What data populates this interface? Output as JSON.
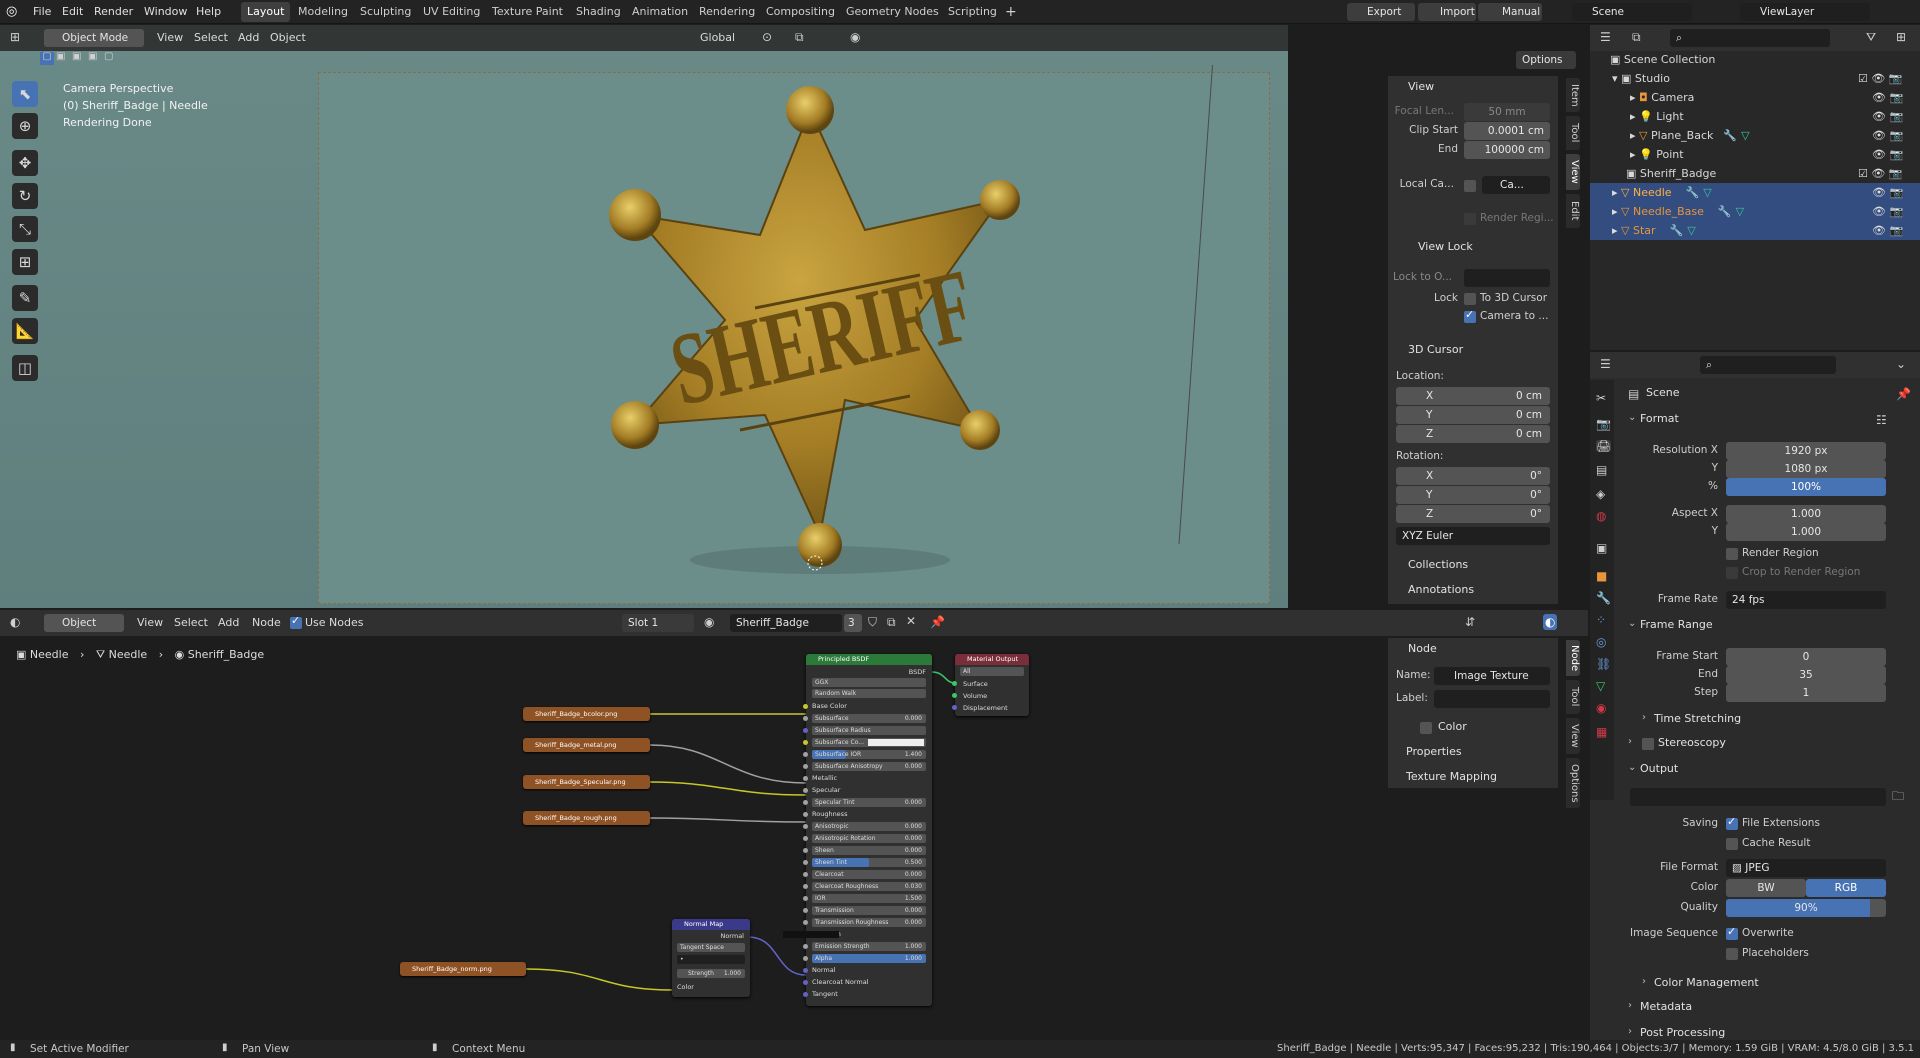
{
  "topbar": {
    "menus": [
      "File",
      "Edit",
      "Render",
      "Window",
      "Help"
    ],
    "workspaces": [
      "Layout",
      "Modeling",
      "Sculpting",
      "UV Editing",
      "Texture Paint",
      "Shading",
      "Animation",
      "Rendering",
      "Compositing",
      "Geometry Nodes",
      "Scripting"
    ],
    "add_tab": "+",
    "export": "Export",
    "import": "Import",
    "manual": "Manual",
    "scene": "Scene",
    "view_layer": "ViewLayer"
  },
  "viewport": {
    "mode": "Object Mode",
    "menus": [
      "View",
      "Select",
      "Add",
      "Object"
    ],
    "orientation": "Global",
    "options": "Options",
    "info_line1": "Camera Perspective",
    "info_line2": "(0) Sheriff_Badge | Needle",
    "info_line3": "Rendering Done",
    "badge_text": "SHERIFF",
    "sidebar": {
      "tabs": [
        "Item",
        "Tool",
        "View",
        "Edit"
      ],
      "view_title": "View",
      "focal_label": "Focal Len...",
      "focal_value": "50 mm",
      "clip_start_label": "Clip Start",
      "clip_start_value": "0.0001 cm",
      "end_label": "End",
      "end_value": "100000 cm",
      "local_camera_label": "Local Ca...",
      "local_camera_value": "Ca...",
      "render_region": "Render Regi...",
      "view_lock_title": "View Lock",
      "lock_to_label": "Lock to O...",
      "lock_label": "Lock",
      "to_3d_cursor": "To 3D Cursor",
      "camera_to": "Camera to ...",
      "cursor_title": "3D Cursor",
      "location_label": "Location:",
      "rotation_label": "Rotation:",
      "x": "X",
      "y": "Y",
      "z": "Z",
      "loc_x": "0 cm",
      "loc_y": "0 cm",
      "loc_z": "0 cm",
      "rot_x": "0°",
      "rot_y": "0°",
      "rot_z": "0°",
      "rotation_mode": "XYZ Euler",
      "collections": "Collections",
      "annotations": "Annotations"
    }
  },
  "node_editor": {
    "object_menu": "Object",
    "menus": [
      "View",
      "Select",
      "Add",
      "Node"
    ],
    "use_nodes": "Use Nodes",
    "slot": "Slot 1",
    "material": "Sheriff_Badge",
    "users": "3",
    "breadcrumb": [
      "Needle",
      "Needle",
      "Sheriff_Badge"
    ],
    "textures": [
      "Sheriff_Badge_bcolor.png",
      "Sheriff_Badge_metal.png",
      "Sheriff_Badge_Specular.png",
      "Sheriff_Badge_rough.png",
      "Sheriff_Badge_norm.png"
    ],
    "bsdf": {
      "title": "Principled BSDF",
      "out": "BSDF",
      "dist": "GGX",
      "sss_method": "Random Walk",
      "rows": [
        [
          "Base Color",
          ""
        ],
        [
          "Subsurface",
          "0.000"
        ],
        [
          "Subsurface Radius",
          ""
        ],
        [
          "Subsurface Co...",
          ""
        ],
        [
          "Subsurface IOR",
          "1.400"
        ],
        [
          "Subsurface Anisotropy",
          "0.000"
        ],
        [
          "Metallic",
          ""
        ],
        [
          "Specular",
          ""
        ],
        [
          "Specular Tint",
          "0.000"
        ],
        [
          "Roughness",
          ""
        ],
        [
          "Anisotropic",
          "0.000"
        ],
        [
          "Anisotropic Rotation",
          "0.000"
        ],
        [
          "Sheen",
          "0.000"
        ],
        [
          "Sheen Tint",
          "0.500"
        ],
        [
          "Clearcoat",
          "0.000"
        ],
        [
          "Clearcoat Roughness",
          "0.030"
        ],
        [
          "IOR",
          "1.500"
        ],
        [
          "Transmission",
          "0.000"
        ],
        [
          "Transmission Roughness",
          "0.000"
        ],
        [
          "Emission",
          ""
        ],
        [
          "Emission Strength",
          "1.000"
        ],
        [
          "Alpha",
          "1.000"
        ],
        [
          "Normal",
          ""
        ],
        [
          "Clearcoat Normal",
          ""
        ],
        [
          "Tangent",
          ""
        ]
      ]
    },
    "output": {
      "title": "Material Output",
      "target": "All",
      "rows": [
        "Surface",
        "Volume",
        "Displacement"
      ]
    },
    "normal_map": {
      "title": "Normal Map",
      "out": "Normal",
      "space": "Tangent Space",
      "strength_label": "Strength",
      "strength": "1.000",
      "color": "Color"
    },
    "sidebar": {
      "tabs": [
        "Node",
        "Tool",
        "View",
        "Options"
      ],
      "node_title": "Node",
      "name_label": "Name:",
      "name_value": "Image Texture",
      "label_label": "Label:",
      "color": "Color",
      "properties": "Properties",
      "texture_mapping": "Texture Mapping"
    }
  },
  "outliner": {
    "items": [
      {
        "name": "Scene Collection"
      },
      {
        "name": "Studio"
      },
      {
        "name": "Camera"
      },
      {
        "name": "Light"
      },
      {
        "name": "Plane_Back"
      },
      {
        "name": "Point"
      },
      {
        "name": "Sheriff_Badge"
      },
      {
        "name": "Needle"
      },
      {
        "name": "Needle_Base"
      },
      {
        "name": "Star"
      }
    ]
  },
  "properties": {
    "scene": "Scene",
    "format": "Format",
    "res_x_label": "Resolution X",
    "res_x": "1920 px",
    "y_label": "Y",
    "res_y": "1080 px",
    "pct_label": "%",
    "pct": "100%",
    "aspect_x_label": "Aspect X",
    "aspect_x": "1.000",
    "aspect_y": "1.000",
    "render_region": "Render Region",
    "crop": "Crop to Render Region",
    "frame_rate_label": "Frame Rate",
    "frame_rate": "24 fps",
    "frame_range": "Frame Range",
    "frame_start_label": "Frame Start",
    "frame_start": "0",
    "end_label": "End",
    "end": "35",
    "step_label": "Step",
    "step": "1",
    "time_stretching": "Time Stretching",
    "stereoscopy": "Stereoscopy",
    "output": "Output",
    "saving_label": "Saving",
    "file_ext": "File Extensions",
    "cache": "Cache Result",
    "file_format_label": "File Format",
    "file_format": "JPEG",
    "color_label": "Color",
    "bw": "BW",
    "rgb": "RGB",
    "quality_label": "Quality",
    "quality": "90%",
    "image_seq_label": "Image Sequence",
    "overwrite": "Overwrite",
    "placeholders": "Placeholders",
    "color_mgmt": "Color Management",
    "metadata": "Metadata",
    "post": "Post Processing"
  },
  "status": {
    "set_modifier": "Set Active Modifier",
    "pan_view": "Pan View",
    "context_menu": "Context Menu",
    "stats": "Sheriff_Badge | Needle | Verts:95,347 | Faces:95,232 | Tris:190,464 | Objects:3/7 | Memory: 1.59 GiB | VRAM: 4.5/8.0 GiB | 3.5.1"
  },
  "colors": {
    "accent": "#4772b3",
    "texture_node": "#8f5224",
    "bsdf_header": "#2b7a3a",
    "output_header": "#7a2e3a",
    "normal_header": "#3b3a8a",
    "selected_row": "#334d80",
    "object_orange": "#e8953b"
  }
}
